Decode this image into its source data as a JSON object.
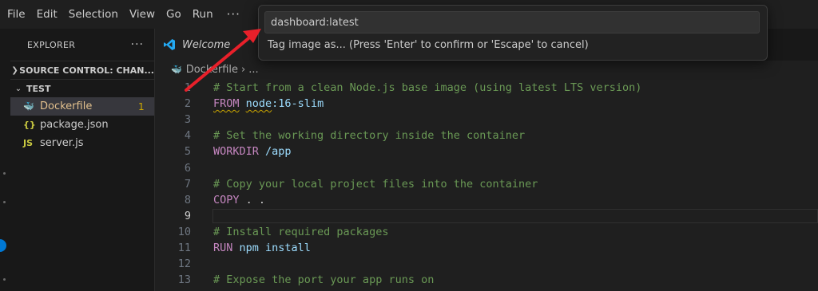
{
  "menu": {
    "items": [
      "File",
      "Edit",
      "Selection",
      "View",
      "Go",
      "Run"
    ],
    "more": "···"
  },
  "sidebar": {
    "title": "EXPLORER",
    "more": "···",
    "sections": [
      {
        "label": "SOURCE CONTROL: CHAN...",
        "expanded": false,
        "chevron": "❯"
      },
      {
        "label": "TEST",
        "expanded": true,
        "chevron": "⌄"
      }
    ],
    "files": [
      {
        "name": "Dockerfile",
        "icon": "docker-icon",
        "glyph": "🐳",
        "badge": "1",
        "selected": true
      },
      {
        "name": "package.json",
        "icon": "json-icon",
        "glyph": "{}",
        "badge": "",
        "selected": false
      },
      {
        "name": "server.js",
        "icon": "js-icon",
        "glyph": "JS",
        "badge": "",
        "selected": false
      }
    ]
  },
  "tabs": [
    {
      "label": "Welcome",
      "icon": "vscode-icon"
    }
  ],
  "breadcrumb": {
    "file": "Dockerfile",
    "separator": "›",
    "more": "..."
  },
  "editor": {
    "active_line": 9,
    "lines": [
      {
        "n": "1",
        "tokens": [
          {
            "t": "# Start from a clean Node.js base image (using latest LTS version)",
            "c": "comment"
          }
        ]
      },
      {
        "n": "2",
        "tokens": [
          {
            "t": "FROM",
            "c": "keyword",
            "sq": true
          },
          {
            "t": " ",
            "c": "plain"
          },
          {
            "t": "node",
            "c": "ident",
            "sq": true
          },
          {
            "t": ":16-slim",
            "c": "ident"
          }
        ]
      },
      {
        "n": "3",
        "tokens": []
      },
      {
        "n": "4",
        "tokens": [
          {
            "t": "# Set the working directory inside the container",
            "c": "comment"
          }
        ]
      },
      {
        "n": "5",
        "tokens": [
          {
            "t": "WORKDIR",
            "c": "keyword"
          },
          {
            "t": " /app",
            "c": "ident"
          }
        ]
      },
      {
        "n": "6",
        "tokens": []
      },
      {
        "n": "7",
        "tokens": [
          {
            "t": "# Copy your local project files into the container",
            "c": "comment"
          }
        ]
      },
      {
        "n": "8",
        "tokens": [
          {
            "t": "COPY",
            "c": "keyword"
          },
          {
            "t": " . .",
            "c": "plain"
          }
        ]
      },
      {
        "n": "9",
        "tokens": []
      },
      {
        "n": "10",
        "tokens": [
          {
            "t": "# Install required packages",
            "c": "comment"
          }
        ]
      },
      {
        "n": "11",
        "tokens": [
          {
            "t": "RUN",
            "c": "keyword"
          },
          {
            "t": " npm install",
            "c": "ident"
          }
        ]
      },
      {
        "n": "12",
        "tokens": []
      },
      {
        "n": "13",
        "tokens": [
          {
            "t": "# Expose the port your app runs on",
            "c": "comment"
          }
        ]
      }
    ]
  },
  "quick_input": {
    "value": "dashboard:latest",
    "message": "Tag image as... (Press 'Enter' to confirm or 'Escape' to cancel)"
  },
  "colors": {
    "accent": "#0078d4",
    "annotation_arrow": "#e8202a",
    "warning": "#cca700"
  }
}
